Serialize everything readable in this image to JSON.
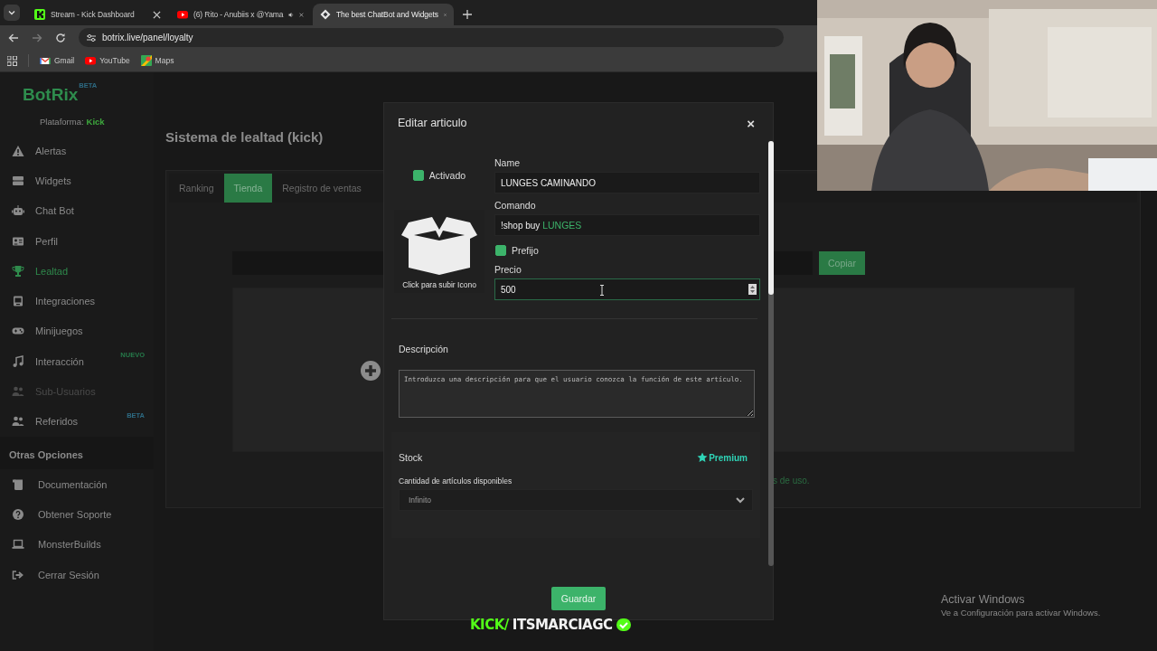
{
  "browser": {
    "tabs": [
      {
        "title": "Stream - Kick Dashboard",
        "kind": "kick",
        "selected": false,
        "audio": false
      },
      {
        "title": "(6) Rito - Anubiis x @Yama",
        "kind": "youtube",
        "selected": false,
        "audio": true
      },
      {
        "title": "The best ChatBot and Widgets",
        "kind": "botrix",
        "selected": true,
        "audio": false
      }
    ],
    "address": "botrix.live/panel/loyalty",
    "bookmarks": [
      {
        "label": "Gmail",
        "kind": "gmail"
      },
      {
        "label": "YouTube",
        "kind": "youtube"
      },
      {
        "label": "Maps",
        "kind": "maps"
      }
    ]
  },
  "sidebar": {
    "logo": "BotRix",
    "logo_badge": "BETA",
    "platform_label": "Plataforma:",
    "platform": "Kick",
    "items": [
      {
        "label": "Alertas",
        "selected": false,
        "disabled": false
      },
      {
        "label": "Widgets",
        "selected": false,
        "disabled": false
      },
      {
        "label": "Chat Bot",
        "selected": false,
        "disabled": false
      },
      {
        "label": "Perfil",
        "selected": false,
        "disabled": false
      },
      {
        "label": "Lealtad",
        "selected": true,
        "disabled": false
      },
      {
        "label": "Integraciones",
        "selected": false,
        "disabled": false
      },
      {
        "label": "Minijuegos",
        "selected": false,
        "disabled": false
      },
      {
        "label": "Interacción",
        "selected": false,
        "disabled": false,
        "badge": "NUEVO"
      },
      {
        "label": "Sub-Usuarios",
        "selected": false,
        "disabled": true
      },
      {
        "label": "Referidos",
        "selected": false,
        "disabled": false,
        "badge": "BETA"
      }
    ],
    "section": "Otras Opciones",
    "other_items": [
      {
        "label": "Documentación"
      },
      {
        "label": "Obtener Soporte"
      },
      {
        "label": "MonsterBuilds"
      },
      {
        "label": "Cerrar Sesión"
      }
    ]
  },
  "main": {
    "title": "Sistema de lealtad (kick)",
    "tabs": [
      {
        "label": "Ranking",
        "selected": false
      },
      {
        "label": "Tienda",
        "selected": true
      },
      {
        "label": "Registro de ventas",
        "selected": false
      }
    ],
    "copy_button": "Copiar",
    "footer_text": "s de uso."
  },
  "modal": {
    "title": "Editar articulo",
    "close": "×",
    "enabled": {
      "label": "Activado",
      "checked": true
    },
    "icon_caption": "Click para subir Icono",
    "name": {
      "label": "Name",
      "value": "LUNGES CAMINANDO"
    },
    "command": {
      "label": "Comando",
      "prefix": "!shop buy",
      "value": "LUNGES"
    },
    "use_prefix": {
      "label": "Prefijo",
      "checked": true
    },
    "price": {
      "label": "Precio",
      "value": "500"
    },
    "description": {
      "label": "Descripción",
      "placeholder": "Introduzca una descripción para que el usuario conozca la función de este artículo."
    },
    "stock": {
      "label": "Stock",
      "premium": "Premium",
      "sublabel": "Cantidad de artículos disponibles",
      "value": "Infinito"
    },
    "save_button": "Guardar"
  },
  "stream_overlay": {
    "platform": "KICK/",
    "channel": "ITSMARCIAGC"
  },
  "windows_notice": {
    "title": "Activar Windows",
    "text": "Ve a Configuración para activar Windows."
  }
}
